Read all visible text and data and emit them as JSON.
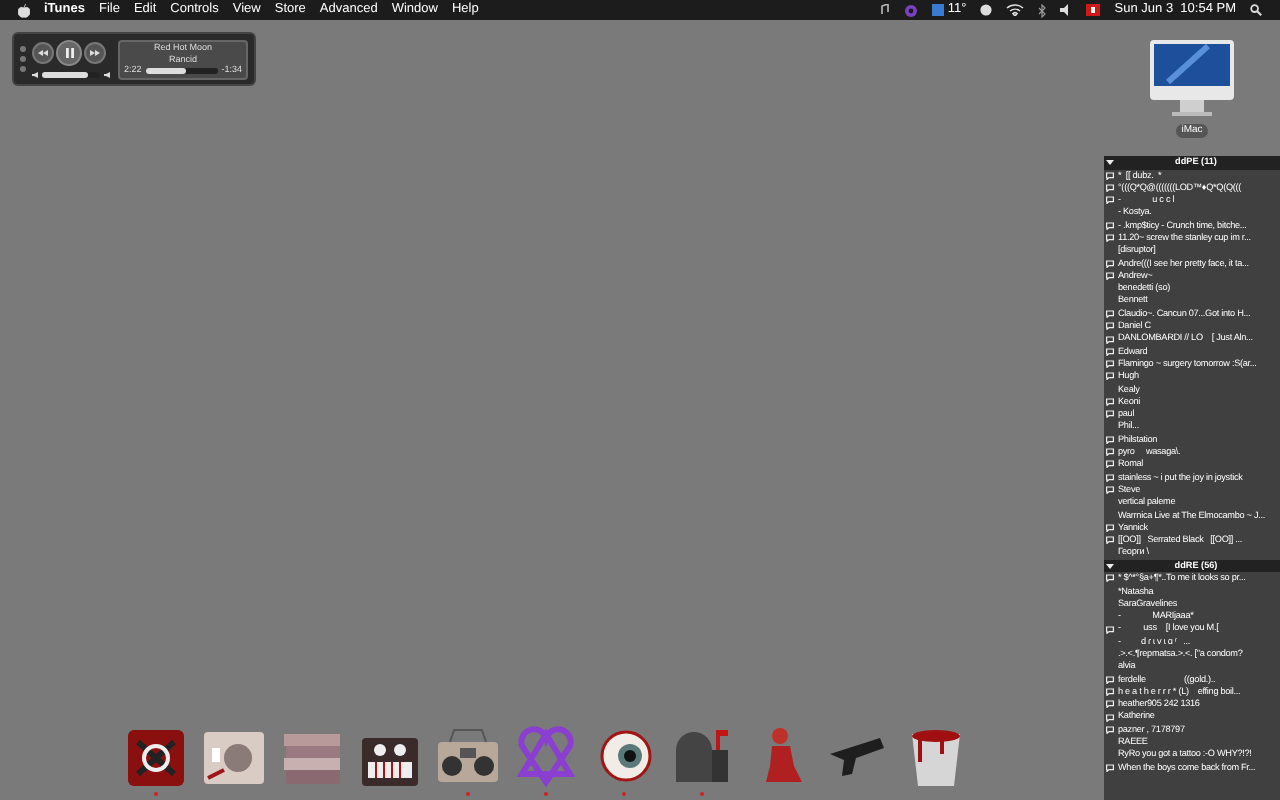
{
  "menu_bar": {
    "app_name": "iTunes",
    "menus": [
      "File",
      "Edit",
      "Controls",
      "View",
      "Store",
      "Advanced",
      "Window",
      "Help"
    ],
    "weather": "11°",
    "clock": "Sun Jun 3  10:54 PM"
  },
  "mini_player": {
    "song": "Red Hot Moon",
    "artist": "Rancid",
    "elapsed": "2:22",
    "remaining": "-1:34",
    "progress": {
      "level": 0.55
    },
    "volume": {
      "level": 0.8
    }
  },
  "desktop_icon": {
    "label": "iMac"
  },
  "buddy_list": {
    "groups": [
      {
        "name": "ddPE (11)",
        "expanded": true,
        "buddies": [
          {
            "name": "*  [[ dubz.  *",
            "status_icon": true
          },
          {
            "name": "°(((Q*Q@(((((((LOD™♦Q*Q(Q(((",
            "status_icon": true
          },
          {
            "name": "-              u c c l",
            "status_icon": true
          },
          {
            "name": "- Kostya.",
            "status_icon": false
          },
          {
            "name": "- .kmp$ticy - Crunch time, bitche...",
            "status_icon": true
          },
          {
            "name": "11.20~ screw the stanley cup im r...",
            "status_icon": true
          },
          {
            "name": "[disruptor]",
            "status_icon": false
          },
          {
            "name": "Andre(((I see her pretty face, it ta...",
            "status_icon": true
          },
          {
            "name": "Andrew~",
            "status_icon": true
          },
          {
            "name": "benedetti (so)",
            "status_icon": false
          },
          {
            "name": "Bennett",
            "status_icon": false
          },
          {
            "name": "Claudio~. Cancun 07...Got into H...",
            "status_icon": true
          },
          {
            "name": "Daniel C",
            "status_icon": true
          },
          {
            "name": "DANLOMBARDI // LO    [ Just Aln...",
            "status_icon": true
          },
          {
            "name": "Edward",
            "status_icon": true
          },
          {
            "name": "Flamingo ~ surgery tomorrow :S(ar...",
            "status_icon": true
          },
          {
            "name": "Hugh",
            "status_icon": true
          },
          {
            "name": "Kealy",
            "status_icon": false
          },
          {
            "name": "Keoni",
            "status_icon": true
          },
          {
            "name": "paul",
            "status_icon": true
          },
          {
            "name": "Phil...",
            "status_icon": false
          },
          {
            "name": "Philstation",
            "status_icon": true
          },
          {
            "name": "pyro     wasaga\\.",
            "status_icon": true
          },
          {
            "name": "Romal",
            "status_icon": true
          },
          {
            "name": "stainless ~ i put the joy in joystick",
            "status_icon": true
          },
          {
            "name": "Steve",
            "status_icon": true
          },
          {
            "name": "vertical paleme",
            "status_icon": false
          },
          {
            "name": "Warrnica Live at The Elmocambo ~ J...",
            "status_icon": false
          },
          {
            "name": "Yannick",
            "status_icon": true
          },
          {
            "name": "[[OO]]   Serrated Black   [[OO]] ...",
            "status_icon": true
          },
          {
            "name": "Георги \\",
            "status_icon": false
          }
        ]
      },
      {
        "name": "ddRE (56)",
        "expanded": true,
        "buddies": [
          {
            "name": "* $^*°§a+¶*..To me it looks so pr...",
            "status_icon": true
          },
          {
            "name": "*Natasha",
            "status_icon": false
          },
          {
            "name": "SaraGravelines",
            "status_icon": false
          },
          {
            "name": "-              MARIjaaa*",
            "status_icon": false
          },
          {
            "name": "-          uss    [I love you M.[",
            "status_icon": true
          },
          {
            "name": "-         d ɾ ɩ v ɩ ɑ ʳ   ...",
            "status_icon": false
          },
          {
            "name": ".>.<.¶repmatsa.>.<. [\"a condom?",
            "status_icon": false
          },
          {
            "name": "alvia",
            "status_icon": false
          },
          {
            "name": "ferdelle                 ((gold.)..",
            "status_icon": true
          },
          {
            "name": "h e a t h e r r r * (L)    effing boil...",
            "status_icon": true
          },
          {
            "name": "heather905 242 1316",
            "status_icon": true
          },
          {
            "name": "Katherine",
            "status_icon": true
          },
          {
            "name": "pazner , 7178797",
            "status_icon": true
          },
          {
            "name": "RAEEE",
            "status_icon": false
          },
          {
            "name": "RyRo you got a tattoo :-O WHY?!?!",
            "status_icon": false
          },
          {
            "name": "When the boys come back from Fr...",
            "status_icon": true
          }
        ]
      }
    ]
  },
  "dock": {
    "items": [
      {
        "kind": "swirl",
        "running": true
      },
      {
        "kind": "applebox",
        "running": false
      },
      {
        "kind": "stack",
        "running": false
      },
      {
        "kind": "synth",
        "running": false
      },
      {
        "kind": "boombox",
        "running": true
      },
      {
        "kind": "heart",
        "running": true
      },
      {
        "kind": "eye",
        "running": true
      },
      {
        "kind": "mailbox",
        "running": true
      },
      {
        "kind": "figure",
        "running": false
      },
      {
        "kind": "pistol",
        "running": false
      },
      {
        "kind": "bucket",
        "running": false
      }
    ]
  }
}
